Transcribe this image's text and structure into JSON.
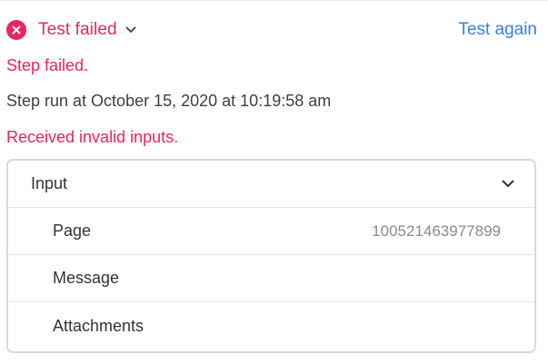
{
  "status": {
    "title": "Test failed",
    "retry_label": "Test again",
    "colors": {
      "error": "#e8265e",
      "link": "#3a7de4"
    }
  },
  "messages": {
    "step_failed": "Step failed.",
    "run_time": "Step run at October 15, 2020 at 10:19:58 am",
    "error_detail": "Received invalid inputs."
  },
  "input_panel": {
    "title": "Input",
    "rows": [
      {
        "label": "Page",
        "value": "100521463977899"
      },
      {
        "label": "Message",
        "value": ""
      },
      {
        "label": "Attachments",
        "value": ""
      }
    ]
  },
  "icons": {
    "status": "close-circle-icon",
    "dropdown": "chevron-down-icon",
    "panel_toggle": "chevron-down-icon"
  }
}
